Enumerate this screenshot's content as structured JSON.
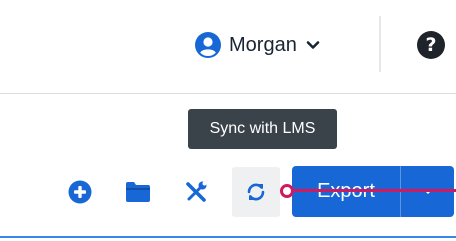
{
  "header": {
    "user": {
      "name": "Morgan",
      "avatar_icon": "user-circle-icon",
      "menu_icon": "chevron-down-icon"
    },
    "help_glyph": "?"
  },
  "tooltip": {
    "text": "Sync with LMS"
  },
  "toolbar": {
    "icons": [
      "plus-circle-icon",
      "folder-icon",
      "tools-icon",
      "sync-icon"
    ],
    "export_label": "Export",
    "export_menu_icon": "caret-down-icon"
  },
  "colors": {
    "accent": "#1768d6",
    "cursor": "#d1195e",
    "tooltip_bg": "#3b434a",
    "text": "#1a2434"
  }
}
